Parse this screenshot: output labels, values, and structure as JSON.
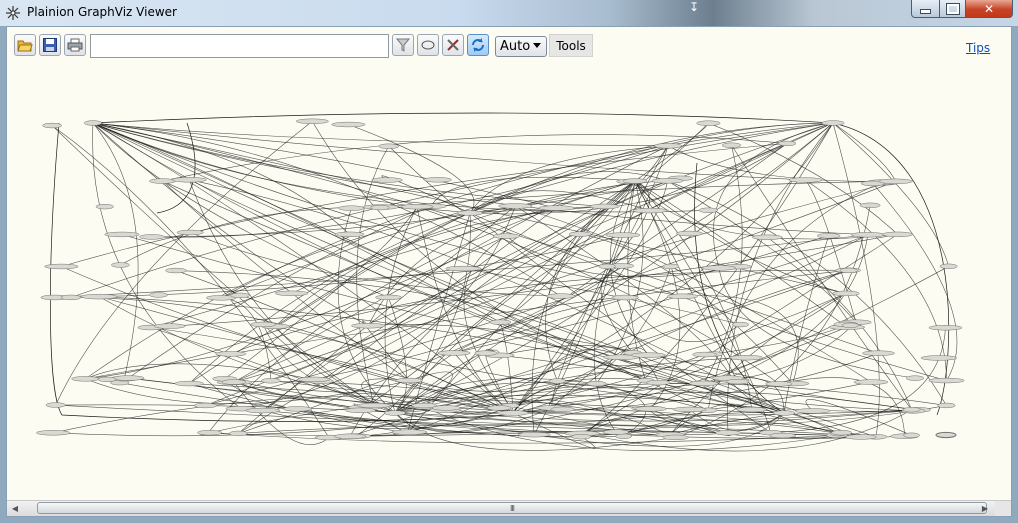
{
  "window": {
    "title": "Plainion GraphViz Viewer",
    "minimize_icon": "minimize-icon",
    "maximize_icon": "maximize-icon",
    "close_icon": "close-icon"
  },
  "toolbar": {
    "open_icon": "folder-open-icon",
    "save_icon": "save-icon",
    "print_icon": "print-icon",
    "search_value": "",
    "search_placeholder": "",
    "filter_icon": "filter-icon",
    "ellipse_icon": "ellipse-icon",
    "settings_icon": "tools-icon",
    "refresh_icon": "refresh-icon",
    "layout_mode": "Auto",
    "tools_label": "Tools",
    "tips_label": "Tips"
  },
  "scrollbar": {
    "grip": "III"
  },
  "colors": {
    "canvas": "#fcfcf3",
    "edge": "#1a1a1a",
    "node_fill": "#d9d9d2",
    "node_stroke": "#707070",
    "refresh_accent": "#2f86d8",
    "link": "#0b4fbf"
  }
}
